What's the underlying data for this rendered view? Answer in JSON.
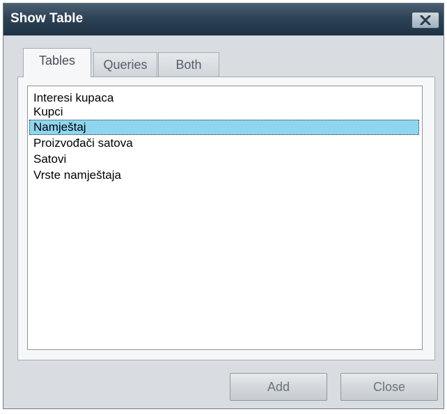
{
  "window": {
    "title": "Show Table"
  },
  "tabs": [
    {
      "label": "Tables",
      "active": true
    },
    {
      "label": "Queries",
      "active": false
    },
    {
      "label": "Both",
      "active": false
    }
  ],
  "list": {
    "items": [
      {
        "label": "Interesi kupaca",
        "selected": false
      },
      {
        "label": "Kupci",
        "selected": false
      },
      {
        "label": "Namještaj",
        "selected": true
      },
      {
        "label": "Proizvođači satova",
        "selected": false
      },
      {
        "label": "Satovi",
        "selected": false
      },
      {
        "label": "Vrste namještaja",
        "selected": false
      }
    ]
  },
  "buttons": {
    "add_label": "Add",
    "close_label": "Close"
  },
  "colors": {
    "titlebar": "#2e4255",
    "selection": "#8fd5ef"
  }
}
